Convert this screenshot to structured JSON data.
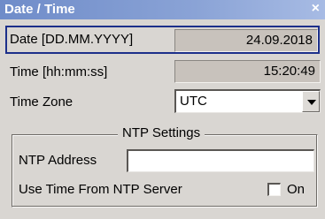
{
  "window": {
    "title": "Date / Time",
    "close_glyph": "×"
  },
  "date": {
    "label": "Date [DD.MM.YYYY]",
    "value": "24.09.2018"
  },
  "time": {
    "label": "Time [hh:mm:ss]",
    "value": "15:20:49"
  },
  "timezone": {
    "label": "Time Zone",
    "selected": "UTC"
  },
  "ntp": {
    "group_title": "NTP Settings",
    "address_label": "NTP Address",
    "address_value": "",
    "use_label": "Use Time From NTP Server",
    "checkbox_label": "On",
    "checked": false
  },
  "colors": {
    "titlebar": "#6f8cc9",
    "focus_frame": "#1c2f8a",
    "readonly_bg": "#c8c2bc",
    "dialog_bg": "#d9d6d2"
  }
}
